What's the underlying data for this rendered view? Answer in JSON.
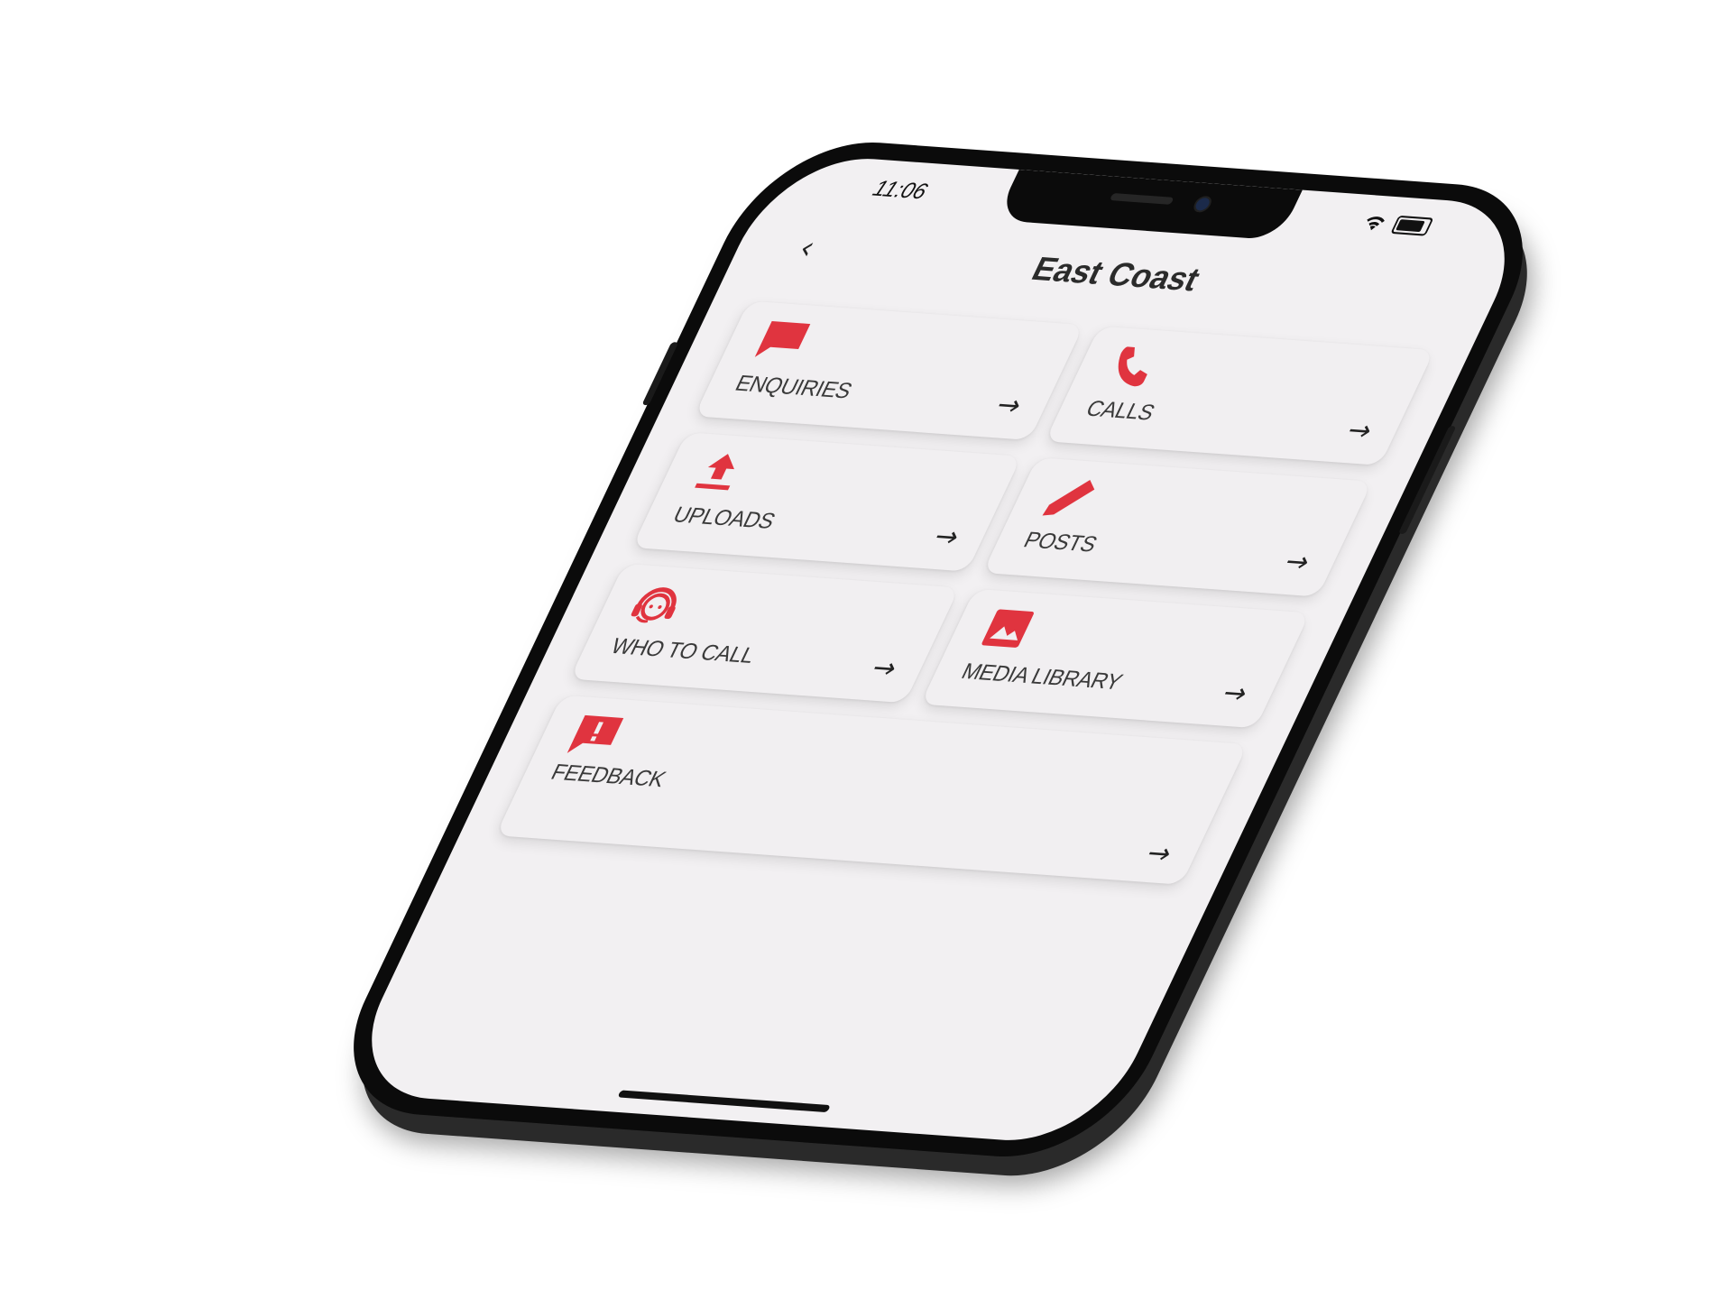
{
  "status_bar": {
    "time": "11:06",
    "icons": [
      "wifi-icon",
      "battery-icon"
    ]
  },
  "header": {
    "back_icon": "‹",
    "title": "East Coast"
  },
  "tiles": [
    {
      "label": "ENQUIRIES",
      "icon": "chat-bubble-icon",
      "arrow": "→"
    },
    {
      "label": "CALLS",
      "icon": "phone-icon",
      "arrow": "→"
    },
    {
      "label": "UPLOADS",
      "icon": "upload-icon",
      "arrow": "→"
    },
    {
      "label": "POSTS",
      "icon": "pencil-icon",
      "arrow": "→"
    },
    {
      "label": "WHO TO CALL",
      "icon": "headset-agent-icon",
      "arrow": "→"
    },
    {
      "label": "MEDIA LIBRARY",
      "icon": "image-icon",
      "arrow": "→"
    },
    {
      "label": "FEEDBACK",
      "icon": "feedback-alert-icon",
      "arrow": "→"
    }
  ],
  "colors": {
    "accent": "#e0343f",
    "screen_bg": "#f2f0f2",
    "text": "#3a3a3a"
  }
}
